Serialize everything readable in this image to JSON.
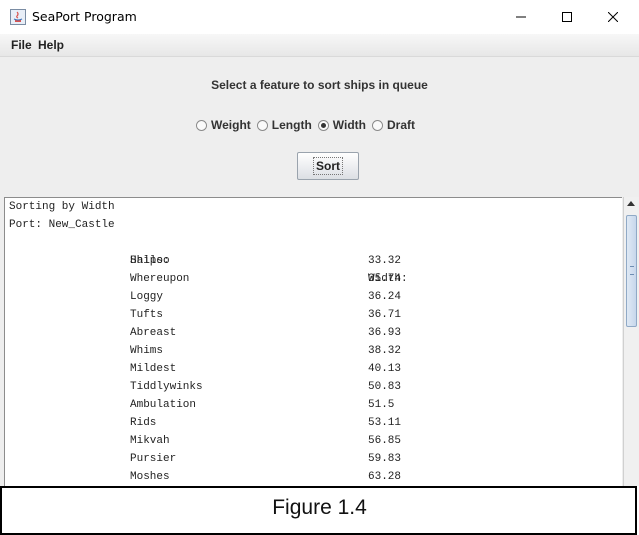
{
  "window": {
    "title": "SeaPort Program",
    "controls": {
      "minimize": "–",
      "maximize": "☐",
      "close": "✕"
    }
  },
  "menu": {
    "file": "File",
    "help": "Help"
  },
  "sort_panel": {
    "prompt": "Select a feature to sort ships in queue",
    "options": [
      "Weight",
      "Length",
      "Width",
      "Draft"
    ],
    "selected": "Width",
    "sort_button": "Sort"
  },
  "output": {
    "line1": "Sorting by Width",
    "line2": "Port: New_Castle",
    "header": {
      "name": "Ships:",
      "value": "Width:"
    },
    "rows": [
      {
        "name": "Halloo",
        "value": "33.32"
      },
      {
        "name": "Whereupon",
        "value": "35.74"
      },
      {
        "name": "Loggy",
        "value": "36.24"
      },
      {
        "name": "Tufts",
        "value": "36.71"
      },
      {
        "name": "Abreast",
        "value": "36.93"
      },
      {
        "name": "Whims",
        "value": "38.32"
      },
      {
        "name": "Mildest",
        "value": "40.13"
      },
      {
        "name": "Tiddlywinks",
        "value": "50.83"
      },
      {
        "name": "Ambulation",
        "value": "51.5"
      },
      {
        "name": "Rids",
        "value": "53.11"
      },
      {
        "name": "Mikvah",
        "value": "56.85"
      },
      {
        "name": "Pursier",
        "value": "59.83"
      },
      {
        "name": "Moshes",
        "value": "63.28"
      }
    ]
  },
  "caption": "Figure 1.4"
}
